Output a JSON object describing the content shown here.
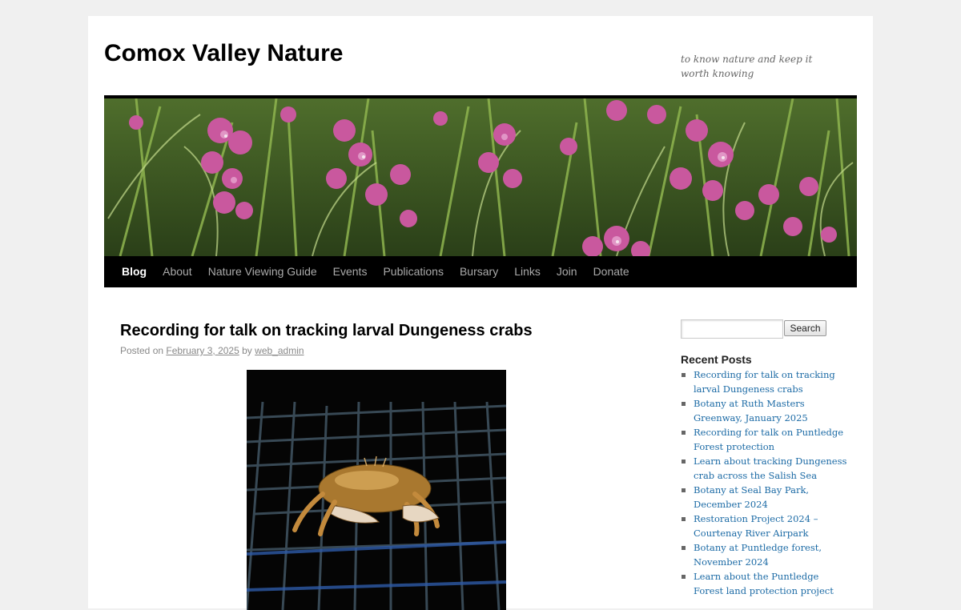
{
  "site": {
    "title": "Comox Valley Nature",
    "description": "to know nature and keep it worth knowing"
  },
  "nav": {
    "items": [
      {
        "label": "Blog",
        "current": true
      },
      {
        "label": "About"
      },
      {
        "label": "Nature Viewing Guide"
      },
      {
        "label": "Events"
      },
      {
        "label": "Publications"
      },
      {
        "label": "Bursary"
      },
      {
        "label": "Links"
      },
      {
        "label": "Join"
      },
      {
        "label": "Donate"
      }
    ]
  },
  "post": {
    "title": "Recording for talk on tracking larval Dungeness crabs",
    "posted_on_label": "Posted on",
    "date": "February 3, 2025",
    "by_label": "by",
    "author": "web_admin"
  },
  "sidebar": {
    "search": {
      "placeholder": "",
      "button_label": "Search"
    },
    "recent_posts_title": "Recent Posts",
    "recent_posts": [
      "Recording for talk on tracking lar­val Dungeness crabs",
      "Botany at Ruth Masters Greenway, January 2025",
      "Recording for talk on Puntledge Forest protection",
      "Learn about tracking Dungeness crab across the Salish Sea",
      "Botany at Seal Bay Park, December 2024",
      "Restoration Project 2024 – Courtenay River Airpark",
      "Botany at Puntledge forest, November 2024",
      "Learn about the Puntledge Forest land protection project"
    ]
  },
  "colors": {
    "nav_bg": "#000000",
    "link": "#1b6aa5",
    "page_bg": "#f0f0f0"
  }
}
